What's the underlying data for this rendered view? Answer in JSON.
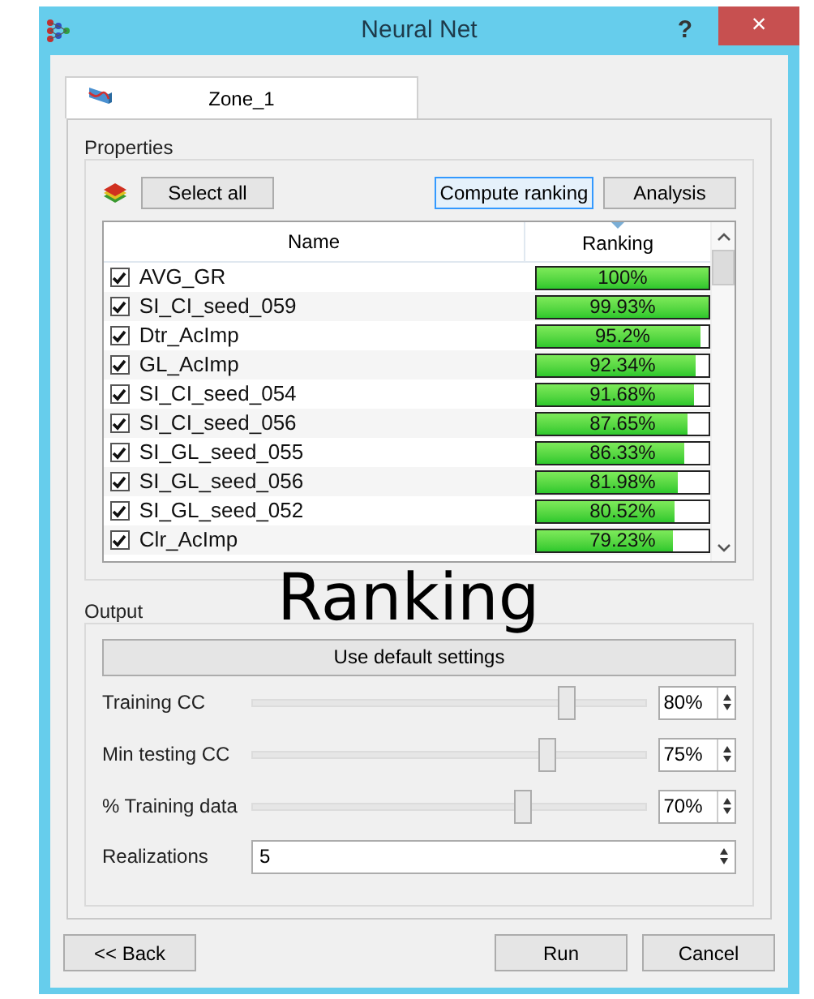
{
  "window": {
    "title": "Neural Net",
    "help": "?",
    "close": "×"
  },
  "tabs": [
    {
      "label": "Zone_1",
      "selected": true
    }
  ],
  "properties": {
    "title": "Properties",
    "select_all": "Select all",
    "compute": "Compute ranking",
    "compute_focused": true,
    "analysis": "Analysis",
    "columns": [
      "Name",
      "Ranking"
    ],
    "rows": [
      {
        "name": "AVG_GR",
        "checked": true,
        "reading": "100%",
        "level": 1.0
      },
      {
        "name": "SI_CI_seed_059",
        "checked": true,
        "reading": "99.93%",
        "level": 0.9993
      },
      {
        "name": "Dtr_AcImp",
        "checked": true,
        "reading": "95.2%",
        "level": 0.952
      },
      {
        "name": "GL_AcImp",
        "checked": true,
        "reading": "92.34%",
        "level": 0.9234
      },
      {
        "name": "SI_CI_seed_054",
        "checked": true,
        "reading": "91.68%",
        "level": 0.9168
      },
      {
        "name": "SI_CI_seed_056",
        "checked": true,
        "reading": "87.65%",
        "level": 0.8765
      },
      {
        "name": "SI_GL_seed_055",
        "checked": true,
        "reading": "86.33%",
        "level": 0.8633
      },
      {
        "name": "SI_GL_seed_056",
        "checked": true,
        "reading": "81.98%",
        "level": 0.8198
      },
      {
        "name": "SI_GL_seed_052",
        "checked": true,
        "reading": "80.52%",
        "level": 0.8052
      },
      {
        "name": "Clr_AcImp",
        "checked": true,
        "reading": "79.23%",
        "level": 0.7923
      }
    ]
  },
  "overlay_caption": "Ranking",
  "output": {
    "title": "Output",
    "default_button": "Use default settings",
    "sliders": [
      {
        "label": "Training CC",
        "level": 0.8,
        "value": "80%"
      },
      {
        "label": "Min testing CC",
        "level": 0.75,
        "value": "75%"
      },
      {
        "label": "% Training data",
        "level": 0.69,
        "value": "70%"
      }
    ],
    "realizations": {
      "label": "Realizations",
      "value": "5"
    }
  },
  "buttons": {
    "back": "<< Back",
    "run": "Run",
    "cancel": "Cancel"
  }
}
